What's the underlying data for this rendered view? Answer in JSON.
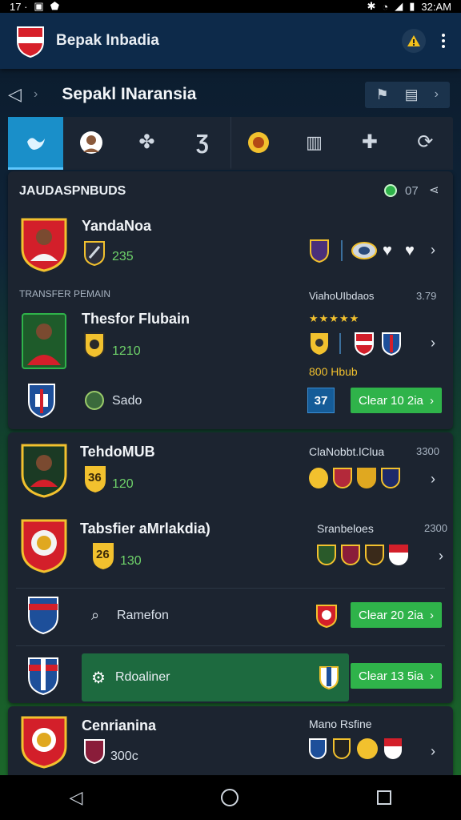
{
  "status": {
    "left": "17 ·",
    "time": "32:AM"
  },
  "appbar": {
    "title": "Bepak Inbadia"
  },
  "subbar": {
    "title": "Sepakl INaransia"
  },
  "tabs": [
    "bird",
    "player",
    "fleur",
    "pin",
    "lion-badge",
    "cage",
    "plane",
    "refresh"
  ],
  "section1": {
    "header": "JAUDASPNBUDS",
    "header_count": "07",
    "player1": {
      "name": "YandaNoa",
      "value": "235"
    },
    "subheader_left": "TRANSFER PEMAIN",
    "subheader_right": "ViahoUIbdaos",
    "subheader_right_num": "3.79",
    "player2": {
      "name": "Thesfor Flubain",
      "value": "1210",
      "stars": "★★★★★",
      "label": "800 Hbub"
    },
    "club_row": {
      "name": "Sado",
      "count": "37",
      "button": "Clear 10 2ia"
    }
  },
  "section2": {
    "row1": {
      "name": "TehdoMUB",
      "badge": "36",
      "value": "120",
      "right_label": "ClaNobbt.lClua",
      "right_num": "3300"
    },
    "row2": {
      "name": "Tabsfier aMrlakdia)",
      "badge": "26",
      "value": "130",
      "right_label": "Sranbeloes",
      "right_num": "2300"
    },
    "row3": {
      "name": "Ramefon",
      "button": "Clear 20 2ia"
    },
    "row4": {
      "name": "Rdoaliner",
      "button": "Clear 13 5ia"
    },
    "row5": {
      "name": "Cenrianina",
      "sub": "300c",
      "right_label": "Mano Rsfine"
    }
  },
  "colors": {
    "accent": "#1a8fc9",
    "green": "#2fb34a",
    "card": "#1c2430"
  }
}
